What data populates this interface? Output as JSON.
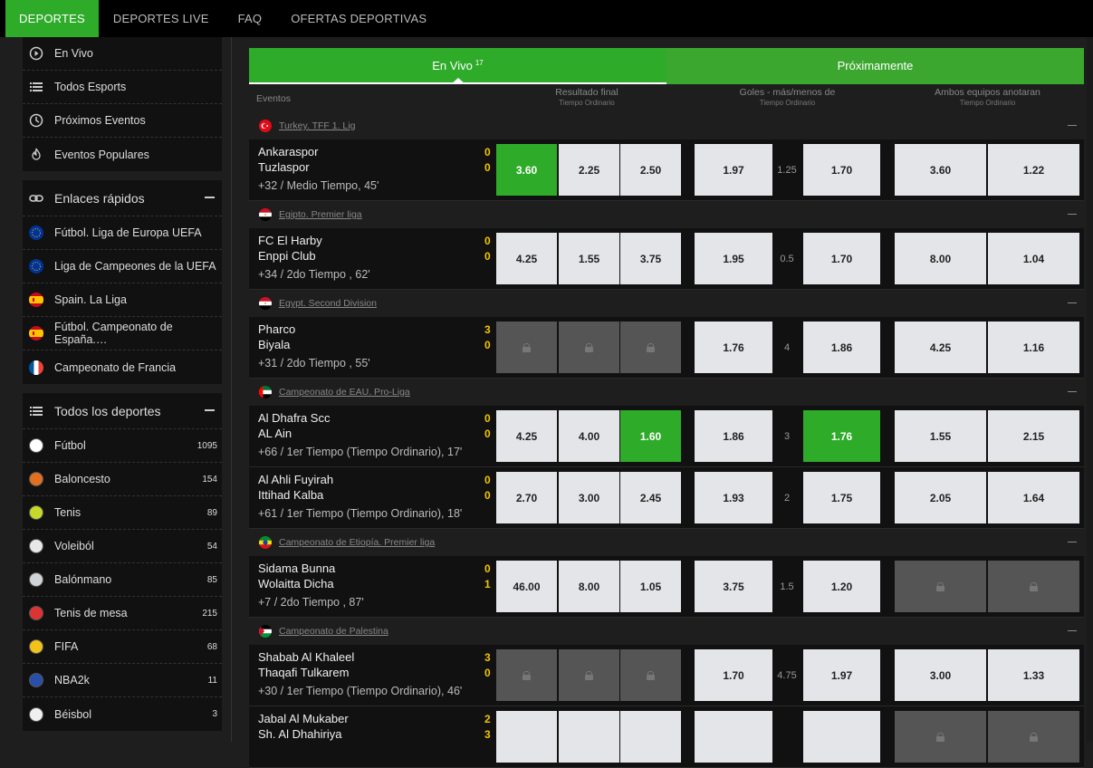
{
  "nav": {
    "tabs": [
      "DEPORTES",
      "DEPORTES LIVE",
      "FAQ",
      "OFERTAS DEPORTIVAS"
    ],
    "active": 0
  },
  "sidebar": {
    "top_items": [
      {
        "label": "En Vivo",
        "icon": "play-circle-icon"
      },
      {
        "label": "Todos Esports",
        "icon": "list-icon"
      },
      {
        "label": "Próximos Eventos",
        "icon": "clock-icon"
      },
      {
        "label": "Eventos Populares",
        "icon": "fire-icon"
      }
    ],
    "quick_links": {
      "title": "Enlaces rápidos",
      "items": [
        {
          "label": "Fútbol. Liga de Europa UEFA",
          "icon": "eu-flag-icon"
        },
        {
          "label": "Liga de Campeones de la UEFA",
          "icon": "eu-flag-icon"
        },
        {
          "label": "Spain. La Liga",
          "icon": "spain-flag-icon"
        },
        {
          "label": "Fútbol. Campeonato de España.…",
          "icon": "spain-flag-icon"
        },
        {
          "label": "Campeonato de Francia",
          "icon": "france-flag-icon"
        }
      ]
    },
    "all_sports": {
      "title": "Todos los deportes",
      "items": [
        {
          "label": "Fútbol",
          "count": "1095",
          "icon": "soccer-ball-icon",
          "color": "#ffffff"
        },
        {
          "label": "Baloncesto",
          "count": "154",
          "icon": "basketball-icon",
          "color": "#e07020"
        },
        {
          "label": "Tenis",
          "count": "89",
          "icon": "tennis-ball-icon",
          "color": "#c8d82a"
        },
        {
          "label": "Voleiból",
          "count": "54",
          "icon": "volleyball-icon",
          "color": "#e8e8e8"
        },
        {
          "label": "Balónmano",
          "count": "85",
          "icon": "handball-icon",
          "color": "#cfd4d8"
        },
        {
          "label": "Tenis de mesa",
          "count": "215",
          "icon": "table-tennis-icon",
          "color": "#d33"
        },
        {
          "label": "FIFA",
          "count": "68",
          "icon": "fifa-icon",
          "color": "#f2c21b"
        },
        {
          "label": "NBA2k",
          "count": "11",
          "icon": "nba-icon",
          "color": "#2a4fa8"
        },
        {
          "label": "Béisbol",
          "count": "3",
          "icon": "baseball-icon",
          "color": "#f0f0f0"
        }
      ]
    }
  },
  "main": {
    "live_tab": "En Vivo",
    "live_count": "17",
    "upcoming_tab": "Próximamente",
    "columns": {
      "events": "Eventos",
      "result": "Resultado final",
      "result_sub": "Tiempo Ordinario",
      "goals": "Goles - más/menos de",
      "goals_sub": "Tiempo Ordinario",
      "btts": "Ambos equipos anotaran",
      "btts_sub": "Tiempo Ordinario"
    },
    "sections": [
      {
        "league": "Turkey. TFF 1. Lig",
        "flag": "turkey",
        "matches": [
          {
            "home": "Ankaraspor",
            "away": "Tuzlaspor",
            "hs": "0",
            "as": "0",
            "info": "+32 / Medio Tiempo, 45'",
            "r": [
              "3.60",
              "2.25",
              "2.50"
            ],
            "g": [
              "1.97",
              "1.25",
              "1.70"
            ],
            "b": [
              "3.60",
              "1.22"
            ],
            "green": [
              "r0"
            ],
            "lock": []
          }
        ]
      },
      {
        "league": "Egipto. Premier liga",
        "flag": "egypt",
        "matches": [
          {
            "home": "FC El Harby",
            "away": "Enppi Club",
            "hs": "0",
            "as": "0",
            "info": "+34 / 2do Tiempo , 62'",
            "r": [
              "4.25",
              "1.55",
              "3.75"
            ],
            "g": [
              "1.95",
              "0.5",
              "1.70"
            ],
            "b": [
              "8.00",
              "1.04"
            ],
            "green": [],
            "lock": []
          }
        ]
      },
      {
        "league": "Egypt. Second Division",
        "flag": "egypt",
        "matches": [
          {
            "home": "Pharco",
            "away": "Biyala",
            "hs": "3",
            "as": "0",
            "info": "+31 / 2do Tiempo , 55'",
            "r": [
              "",
              "",
              ""
            ],
            "g": [
              "1.76",
              "4",
              "1.86"
            ],
            "b": [
              "4.25",
              "1.16"
            ],
            "green": [],
            "lock": [
              "r"
            ]
          }
        ]
      },
      {
        "league": "Campeonato de EAU. Pro-Liga",
        "flag": "uae",
        "matches": [
          {
            "home": "Al Dhafra Scc",
            "away": "AL Ain",
            "hs": "0",
            "as": "0",
            "info": "+66 / 1er Tiempo (Tiempo Ordinario), 17'",
            "r": [
              "4.25",
              "4.00",
              "1.60"
            ],
            "g": [
              "1.86",
              "3",
              "1.76"
            ],
            "b": [
              "1.55",
              "2.15"
            ],
            "green": [
              "r2",
              "g2"
            ],
            "lock": []
          },
          {
            "home": "Al Ahli Fuyirah",
            "away": "Ittihad Kalba",
            "hs": "0",
            "as": "0",
            "info": "+61 / 1er Tiempo (Tiempo Ordinario), 18'",
            "r": [
              "2.70",
              "3.00",
              "2.45"
            ],
            "g": [
              "1.93",
              "2",
              "1.75"
            ],
            "b": [
              "2.05",
              "1.64"
            ],
            "green": [],
            "lock": []
          }
        ]
      },
      {
        "league": "Campeonato de Etiopía. Premier liga",
        "flag": "ethiopia",
        "matches": [
          {
            "home": "Sidama Bunna",
            "away": "Wolaitta Dicha",
            "hs": "0",
            "as": "1",
            "info": "+7 / 2do Tiempo , 87'",
            "r": [
              "46.00",
              "8.00",
              "1.05"
            ],
            "g": [
              "3.75",
              "1.5",
              "1.20"
            ],
            "b": [
              "",
              ""
            ],
            "green": [],
            "lock": [
              "b"
            ]
          }
        ]
      },
      {
        "league": "Campeonato de Palestina",
        "flag": "palestine",
        "matches": [
          {
            "home": "Shabab Al Khaleel",
            "away": "Thaqafi Tulkarem",
            "hs": "3",
            "as": "0",
            "info": "+30 / 1er Tiempo (Tiempo Ordinario), 46'",
            "r": [
              "",
              "",
              ""
            ],
            "g": [
              "1.70",
              "4.75",
              "1.97"
            ],
            "b": [
              "3.00",
              "1.33"
            ],
            "green": [],
            "lock": [
              "r"
            ]
          },
          {
            "home": "Jabal Al Mukaber",
            "away": "Sh. Al Dhahiriya",
            "hs": "2",
            "as": "3",
            "info": "",
            "r": [
              "",
              "",
              ""
            ],
            "g": [
              "",
              "",
              ""
            ],
            "b": [
              "",
              ""
            ],
            "green": [],
            "lock": [
              "b"
            ]
          }
        ]
      }
    ]
  },
  "colors": {
    "accent": "#2fab2a",
    "score": "#f5c400"
  }
}
